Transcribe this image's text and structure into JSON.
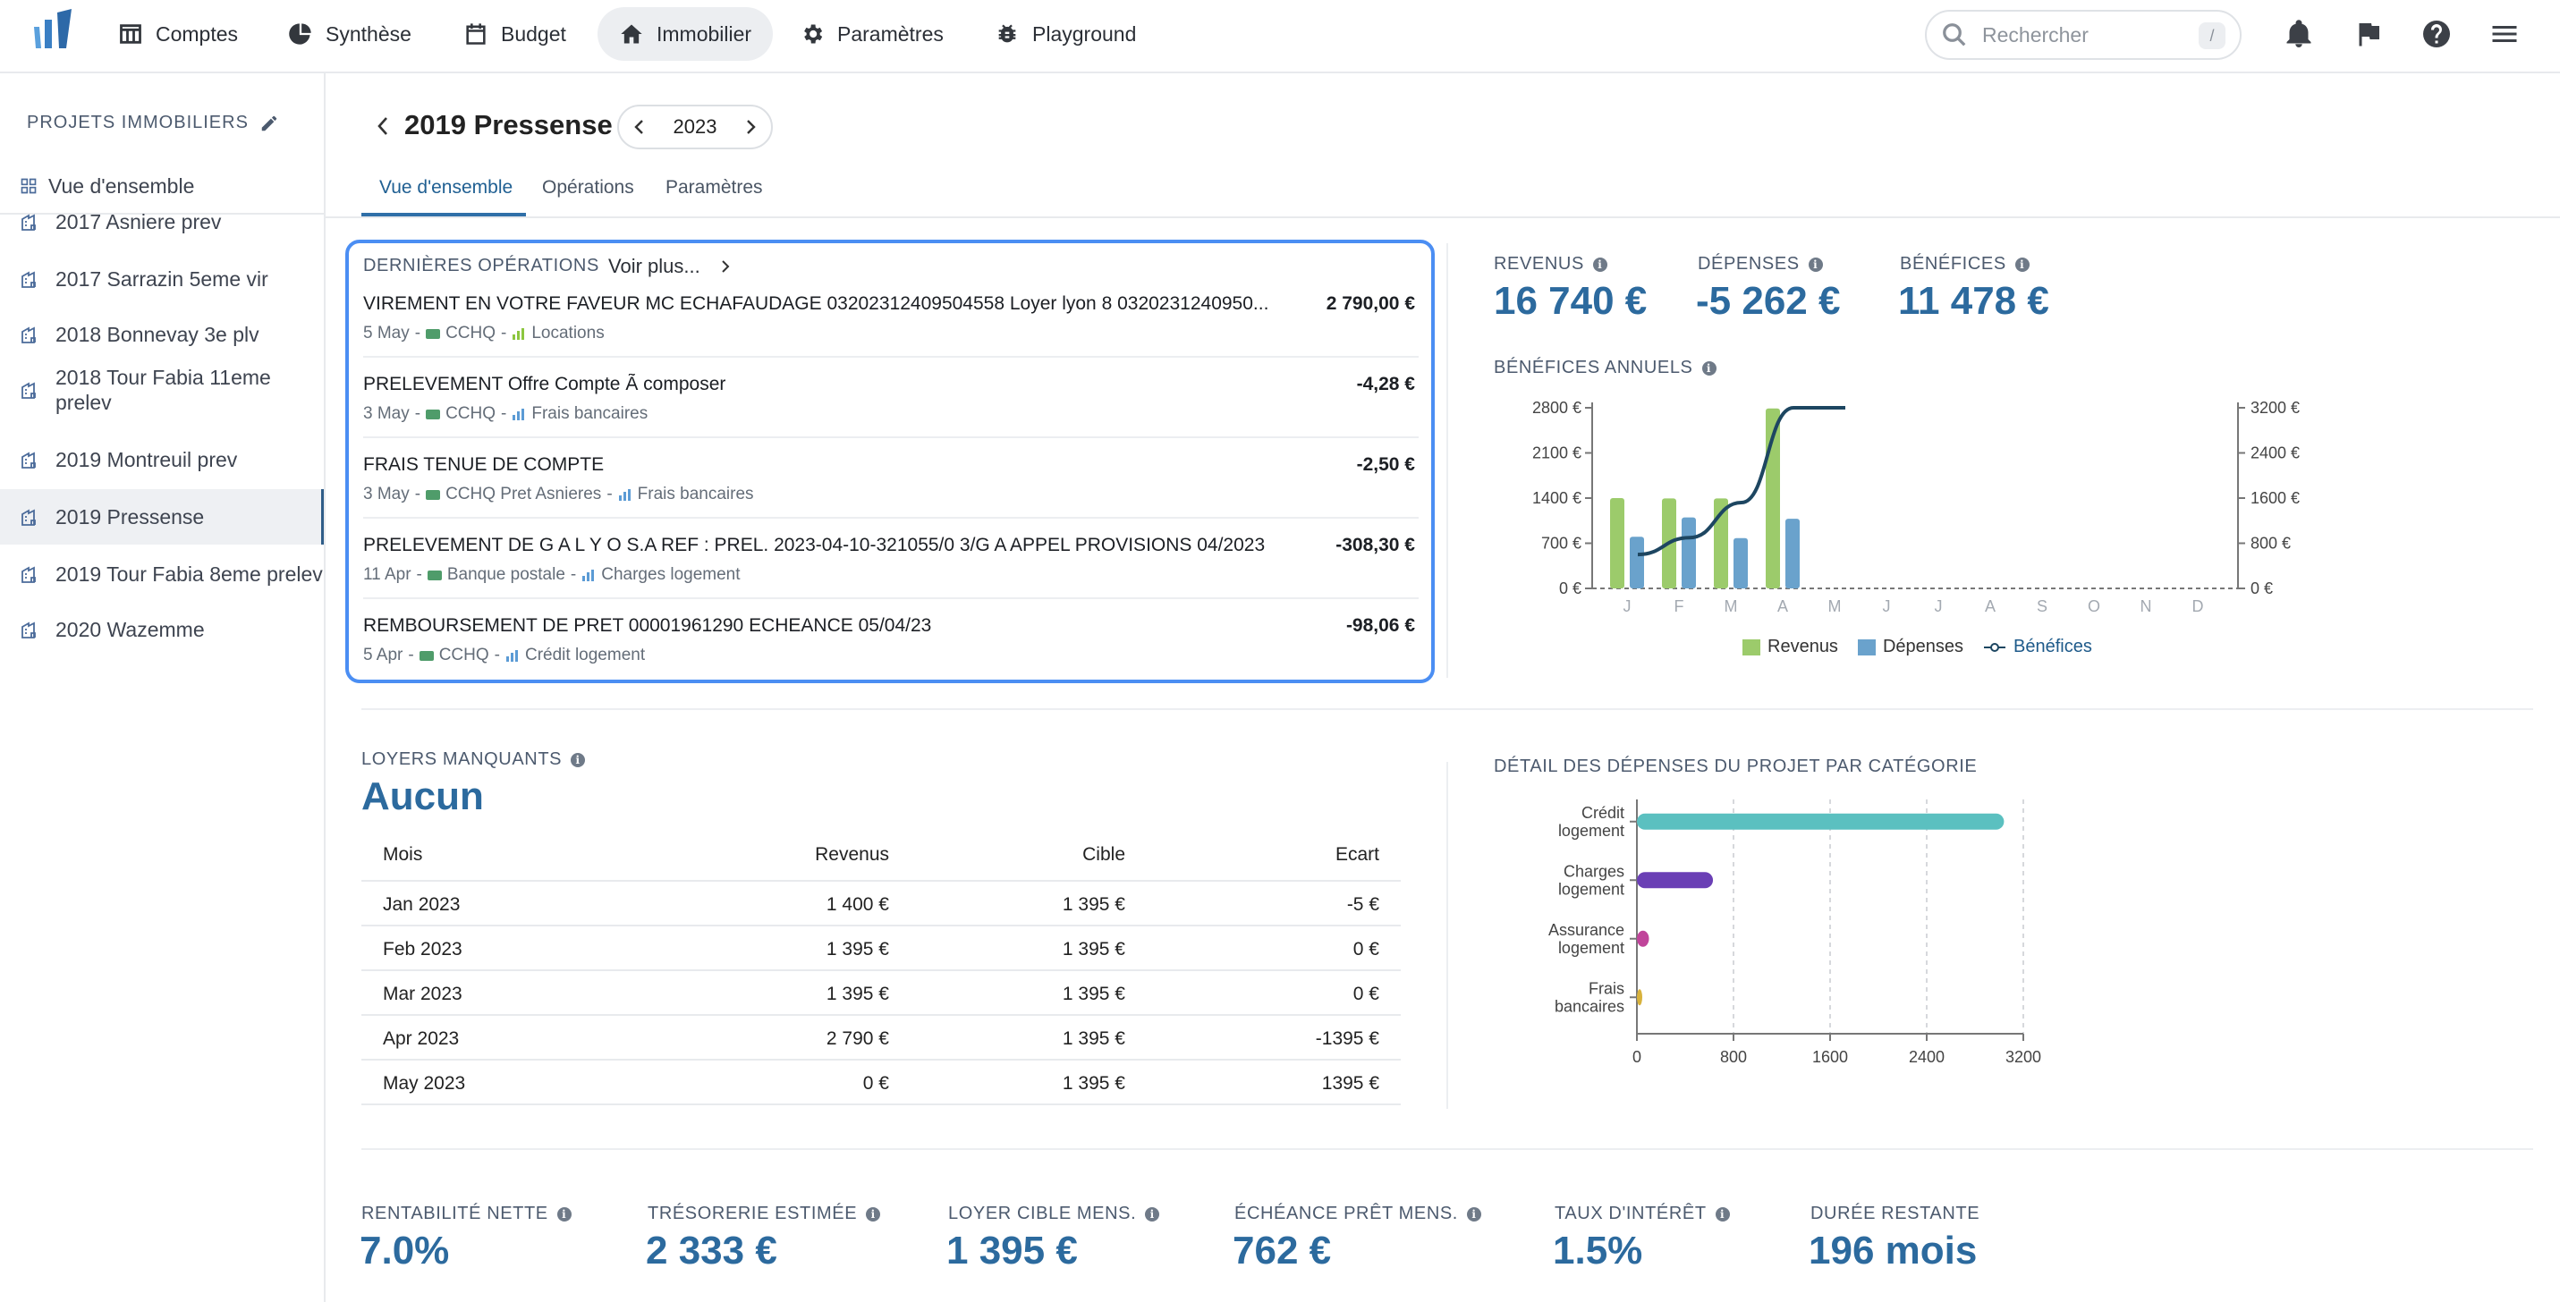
{
  "nav": {
    "items": [
      {
        "label": "Comptes",
        "icon": "table-icon"
      },
      {
        "label": "Synthèse",
        "icon": "pie-chart-icon"
      },
      {
        "label": "Budget",
        "icon": "calendar-icon"
      },
      {
        "label": "Immobilier",
        "icon": "home-icon",
        "active": true
      },
      {
        "label": "Paramètres",
        "icon": "gear-icon"
      },
      {
        "label": "Playground",
        "icon": "bug-icon"
      }
    ],
    "search_placeholder": "Rechercher",
    "search_shortcut": "/"
  },
  "sidebar": {
    "heading": "PROJETS IMMOBILIERS",
    "overview": "Vue d'ensemble",
    "items": [
      "2017 Asniere prev",
      "2017 Sarrazin 5eme vir",
      "2018 Bonnevay 3e plv",
      "2018 Tour Fabia 11eme prelev",
      "2019 Montreuil prev",
      "2019 Pressense",
      "2019 Tour Fabia 8eme prelev",
      "2020 Wazemme"
    ],
    "active_index": 5
  },
  "header": {
    "title": "2019 Pressense",
    "year": "2023",
    "tabs": [
      "Vue d'ensemble",
      "Opérations",
      "Paramètres"
    ],
    "active_tab": 0
  },
  "operations": {
    "heading": "DERNIÈRES OPÉRATIONS",
    "more": "Voir plus...",
    "items": [
      {
        "title": "VIREMENT EN VOTRE FAVEUR MC ECHAFAUDAGE 03202312409504558 Loyer lyon 8 0320231240950...",
        "amount": "2 790,00 €",
        "date": "5 May",
        "account": "CCHQ",
        "category": "Locations",
        "cat_color": "#8cc63f"
      },
      {
        "title": "PRELEVEMENT Offre Compte Ã  composer",
        "amount": "-4,28 €",
        "date": "3 May",
        "account": "CCHQ",
        "category": "Frais bancaires",
        "cat_color": "#5b9bd5"
      },
      {
        "title": "FRAIS TENUE DE COMPTE",
        "amount": "-2,50 €",
        "date": "3 May",
        "account": "CCHQ Pret Asnieres",
        "category": "Frais bancaires",
        "cat_color": "#5b9bd5"
      },
      {
        "title": "PRELEVEMENT DE G A L Y O S.A REF : PREL. 2023-04-10-321055/0 3/G A APPEL PROVISIONS 04/2023",
        "amount": "-308,30 €",
        "date": "11 Apr",
        "account": "Banque postale",
        "category": "Charges logement",
        "cat_color": "#5b9bd5"
      },
      {
        "title": "REMBOURSEMENT DE PRET 00001961290 ECHEANCE 05/04/23",
        "amount": "-98,06 €",
        "date": "5 Apr",
        "account": "CCHQ",
        "category": "Crédit logement",
        "cat_color": "#5b9bd5"
      }
    ]
  },
  "summary": {
    "revenus_label": "REVENUS",
    "revenus": "16 740 €",
    "depenses_label": "DÉPENSES",
    "depenses": "-5 262 €",
    "benefices_label": "BÉNÉFICES",
    "benefices": "11 478 €"
  },
  "missing_rent": {
    "label": "LOYERS MANQUANTS",
    "value": "Aucun",
    "headers": [
      "Mois",
      "Revenus",
      "Cible",
      "Ecart"
    ],
    "rows": [
      [
        "Jan 2023",
        "1 400 €",
        "1 395 €",
        "-5 €"
      ],
      [
        "Feb 2023",
        "1 395 €",
        "1 395 €",
        "0 €"
      ],
      [
        "Mar 2023",
        "1 395 €",
        "1 395 €",
        "0 €"
      ],
      [
        "Apr 2023",
        "2 790 €",
        "1 395 €",
        "-1395 €"
      ],
      [
        "May 2023",
        "0 €",
        "1 395 €",
        "1395 €"
      ]
    ]
  },
  "kpis": [
    {
      "label": "RENTABILITÉ NETTE",
      "value": "7.0%",
      "info": true
    },
    {
      "label": "TRÉSORERIE ESTIMÉE",
      "value": "2 333 €",
      "info": true
    },
    {
      "label": "LOYER CIBLE MENS.",
      "value": "1 395 €",
      "info": true
    },
    {
      "label": "ÉCHÉANCE PRÊT MENS.",
      "value": "762 €",
      "info": true
    },
    {
      "label": "TAUX D'INTÉRÊT",
      "value": "1.5%",
      "info": true
    },
    {
      "label": "DURÉE RESTANTE",
      "value": "196 mois",
      "info": false
    }
  ],
  "chart_data": [
    {
      "type": "bar",
      "title": "BÉNÉFICES ANNUELS",
      "categories": [
        "J",
        "F",
        "M",
        "A",
        "M",
        "J",
        "J",
        "A",
        "S",
        "O",
        "N",
        "D"
      ],
      "series": [
        {
          "name": "Revenus",
          "values": [
            1400,
            1395,
            1395,
            2790,
            0,
            0,
            0,
            0,
            0,
            0,
            0,
            0
          ],
          "color": "#9ccb6b"
        },
        {
          "name": "Dépenses",
          "values": [
            800,
            1100,
            780,
            1080,
            0,
            0,
            0,
            0,
            0,
            0,
            0,
            0
          ],
          "color": "#6aa2cc"
        },
        {
          "name": "Bénéfices",
          "type": "line",
          "axis": "right",
          "values": [
            600,
            900,
            1520,
            3200,
            3200
          ],
          "color": "#1d4661"
        }
      ],
      "yticks_left": [
        "0 €",
        "700 €",
        "1400 €",
        "2100 €",
        "2800 €"
      ],
      "ylim_left": [
        0,
        2800
      ],
      "yticks_right": [
        "0 €",
        "800 €",
        "1600 €",
        "2400 €",
        "3200 €"
      ],
      "ylim_right": [
        0,
        3200
      ],
      "legend": "bottom"
    },
    {
      "type": "bar",
      "orientation": "horizontal",
      "title": "DÉTAIL DES DÉPENSES DU PROJET PAR CATÉGORIE",
      "categories": [
        [
          "Crédit",
          "logement"
        ],
        [
          "Charges",
          "logement"
        ],
        [
          "Assurance",
          "logement"
        ],
        [
          "Frais",
          "bancaires"
        ]
      ],
      "values": [
        3040,
        630,
        100,
        25
      ],
      "colors": [
        "#5bc0c0",
        "#6a3fb5",
        "#c0449a",
        "#d8b23c"
      ],
      "xticks": [
        "0",
        "800",
        "1600",
        "2400",
        "3200"
      ],
      "xlim": [
        0,
        3200
      ]
    }
  ]
}
